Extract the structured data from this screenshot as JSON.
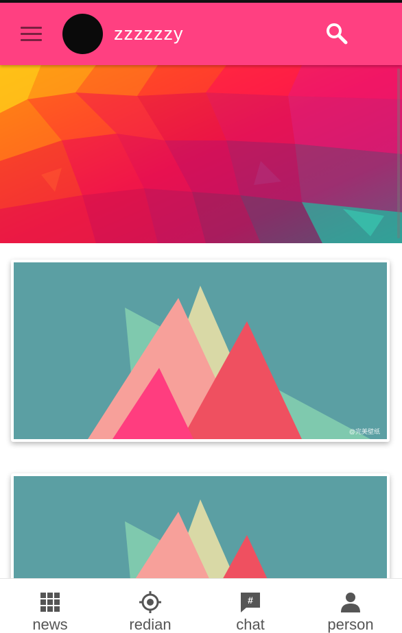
{
  "header": {
    "username": "zzzzzzy",
    "accent_color": "#ff4081",
    "menu_icon": "hamburger-menu-icon",
    "search_icon": "search-icon"
  },
  "banner": {
    "image": "low-poly-gradient-banner"
  },
  "feed": {
    "cards": [
      {
        "image": "low-poly-mountains-image",
        "watermark": "@完美壁纸"
      },
      {
        "image": "low-poly-mountains-image"
      }
    ]
  },
  "bottom_nav": {
    "items": [
      {
        "label": "news",
        "icon": "grid-icon"
      },
      {
        "label": "redian",
        "icon": "target-icon"
      },
      {
        "label": "chat",
        "icon": "chat-hash-icon"
      },
      {
        "label": "person",
        "icon": "person-icon"
      }
    ]
  }
}
